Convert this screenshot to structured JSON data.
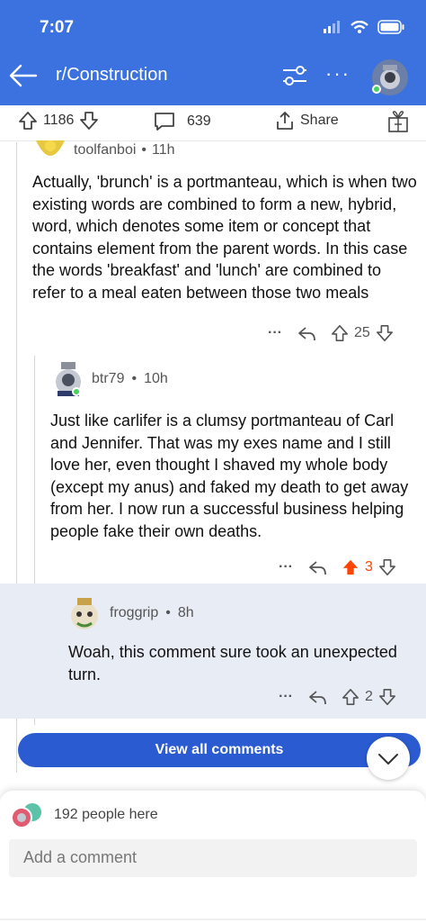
{
  "status_bar": {
    "time": "7:07"
  },
  "header": {
    "title": "r/Construction"
  },
  "post_bar": {
    "upvotes": "1186",
    "comments": "639",
    "share_label": "Share"
  },
  "comments": [
    {
      "username": "toolfanboi",
      "age": "11h",
      "text": "Actually, 'brunch' is a portmanteau, which is when two existing words are combined to form a new, hybrid, word, which denotes some item or concept that contains element from the parent words. In this case the words 'breakfast' and 'lunch' are combined to refer to a meal eaten between those two meals",
      "score": "25"
    },
    {
      "username": "btr79",
      "age": "10h",
      "text": "Just like carlifer is a clumsy portmanteau of Carl and Jennifer. That was my exes name and I still love her, even thought I shaved my whole body (except my anus) and faked my death to get away from her. I now run a successful business helping people fake their own deaths.",
      "score": "3"
    },
    {
      "username": "froggrip",
      "age": "8h",
      "text": "Woah, this comment sure took an unexpected turn.",
      "score": "2"
    }
  ],
  "separator": "•",
  "more_symbol": "···",
  "view_all_label": "View all comments",
  "presence": {
    "text": "192 people here"
  },
  "composer": {
    "placeholder": "Add a comment"
  },
  "colors": {
    "header": "#3b72e0",
    "upvote_active": "#ff4500",
    "button": "#2a5bd0"
  }
}
